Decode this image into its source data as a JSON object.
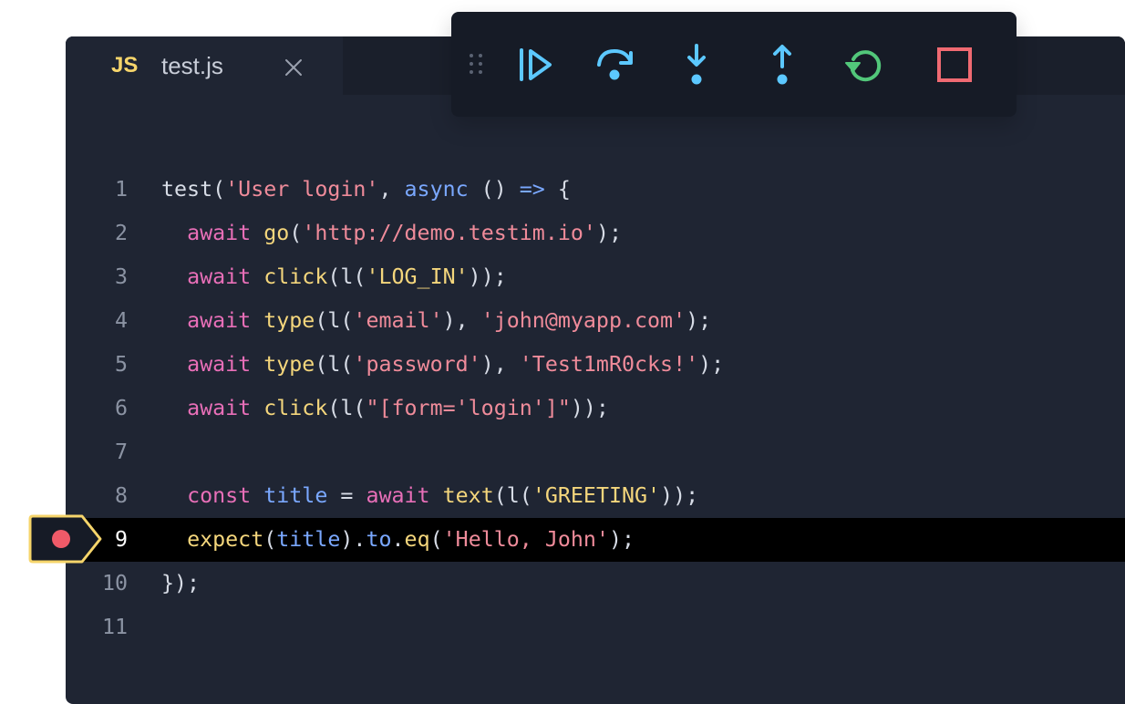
{
  "tab": {
    "lang_badge": "JS",
    "filename": "test.js"
  },
  "toolbar": {
    "buttons": [
      {
        "name": "drag-handle-icon"
      },
      {
        "name": "continue-icon",
        "color": "#5cc8ff"
      },
      {
        "name": "step-over-icon",
        "color": "#5cc8ff"
      },
      {
        "name": "step-into-icon",
        "color": "#5cc8ff"
      },
      {
        "name": "step-out-icon",
        "color": "#5cc8ff"
      },
      {
        "name": "restart-icon",
        "color": "#52c77a"
      },
      {
        "name": "stop-icon",
        "color": "#f06a72"
      }
    ]
  },
  "breakpoint": {
    "line": 9,
    "color": "#f05a68",
    "border": "#f6d56b"
  },
  "code": {
    "line_numbers": [
      "1",
      "2",
      "3",
      "4",
      "5",
      "6",
      "7",
      "8",
      "9",
      "10",
      "11"
    ],
    "active_line": 9,
    "lines": [
      [
        {
          "t": "pl",
          "s": "test("
        },
        {
          "t": "str",
          "s": "'User login'"
        },
        {
          "t": "pl",
          "s": ", "
        },
        {
          "t": "var",
          "s": "async"
        },
        {
          "t": "pl",
          "s": " () "
        },
        {
          "t": "var",
          "s": "=>"
        },
        {
          "t": "pl",
          "s": " {"
        }
      ],
      [
        {
          "t": "pl",
          "s": "  "
        },
        {
          "t": "kw",
          "s": "await"
        },
        {
          "t": "pl",
          "s": " "
        },
        {
          "t": "fn",
          "s": "go"
        },
        {
          "t": "pl",
          "s": "("
        },
        {
          "t": "str",
          "s": "'http://demo.testim.io'"
        },
        {
          "t": "pl",
          "s": ");"
        }
      ],
      [
        {
          "t": "pl",
          "s": "  "
        },
        {
          "t": "kw",
          "s": "await"
        },
        {
          "t": "pl",
          "s": " "
        },
        {
          "t": "fn",
          "s": "click"
        },
        {
          "t": "pl",
          "s": "(l("
        },
        {
          "t": "fn",
          "s": "'LOG_IN'"
        },
        {
          "t": "pl",
          "s": "));"
        }
      ],
      [
        {
          "t": "pl",
          "s": "  "
        },
        {
          "t": "kw",
          "s": "await"
        },
        {
          "t": "pl",
          "s": " "
        },
        {
          "t": "fn",
          "s": "type"
        },
        {
          "t": "pl",
          "s": "(l("
        },
        {
          "t": "str",
          "s": "'email'"
        },
        {
          "t": "pl",
          "s": "), "
        },
        {
          "t": "str",
          "s": "'john@myapp.com'"
        },
        {
          "t": "pl",
          "s": ");"
        }
      ],
      [
        {
          "t": "pl",
          "s": "  "
        },
        {
          "t": "kw",
          "s": "await"
        },
        {
          "t": "pl",
          "s": " "
        },
        {
          "t": "fn",
          "s": "type"
        },
        {
          "t": "pl",
          "s": "(l("
        },
        {
          "t": "str",
          "s": "'password'"
        },
        {
          "t": "pl",
          "s": "), "
        },
        {
          "t": "str",
          "s": "'Test1mR0cks!'"
        },
        {
          "t": "pl",
          "s": ");"
        }
      ],
      [
        {
          "t": "pl",
          "s": "  "
        },
        {
          "t": "kw",
          "s": "await"
        },
        {
          "t": "pl",
          "s": " "
        },
        {
          "t": "fn",
          "s": "click"
        },
        {
          "t": "pl",
          "s": "(l("
        },
        {
          "t": "str",
          "s": "\"[form='login']\""
        },
        {
          "t": "pl",
          "s": "));"
        }
      ],
      [],
      [
        {
          "t": "pl",
          "s": "  "
        },
        {
          "t": "kw",
          "s": "const"
        },
        {
          "t": "pl",
          "s": " "
        },
        {
          "t": "var",
          "s": "title"
        },
        {
          "t": "pl",
          "s": " = "
        },
        {
          "t": "kw",
          "s": "await"
        },
        {
          "t": "pl",
          "s": " "
        },
        {
          "t": "fn",
          "s": "text"
        },
        {
          "t": "pl",
          "s": "(l("
        },
        {
          "t": "fn",
          "s": "'GREETING'"
        },
        {
          "t": "pl",
          "s": "));"
        }
      ],
      [
        {
          "t": "pl",
          "s": "  "
        },
        {
          "t": "fn",
          "s": "expect"
        },
        {
          "t": "pl",
          "s": "("
        },
        {
          "t": "var",
          "s": "title"
        },
        {
          "t": "pl",
          "s": ")."
        },
        {
          "t": "var",
          "s": "to"
        },
        {
          "t": "pl",
          "s": "."
        },
        {
          "t": "fn",
          "s": "eq"
        },
        {
          "t": "pl",
          "s": "("
        },
        {
          "t": "str",
          "s": "'Hello, John'"
        },
        {
          "t": "pl",
          "s": ");"
        }
      ],
      [
        {
          "t": "pl",
          "s": "});"
        }
      ],
      []
    ]
  }
}
